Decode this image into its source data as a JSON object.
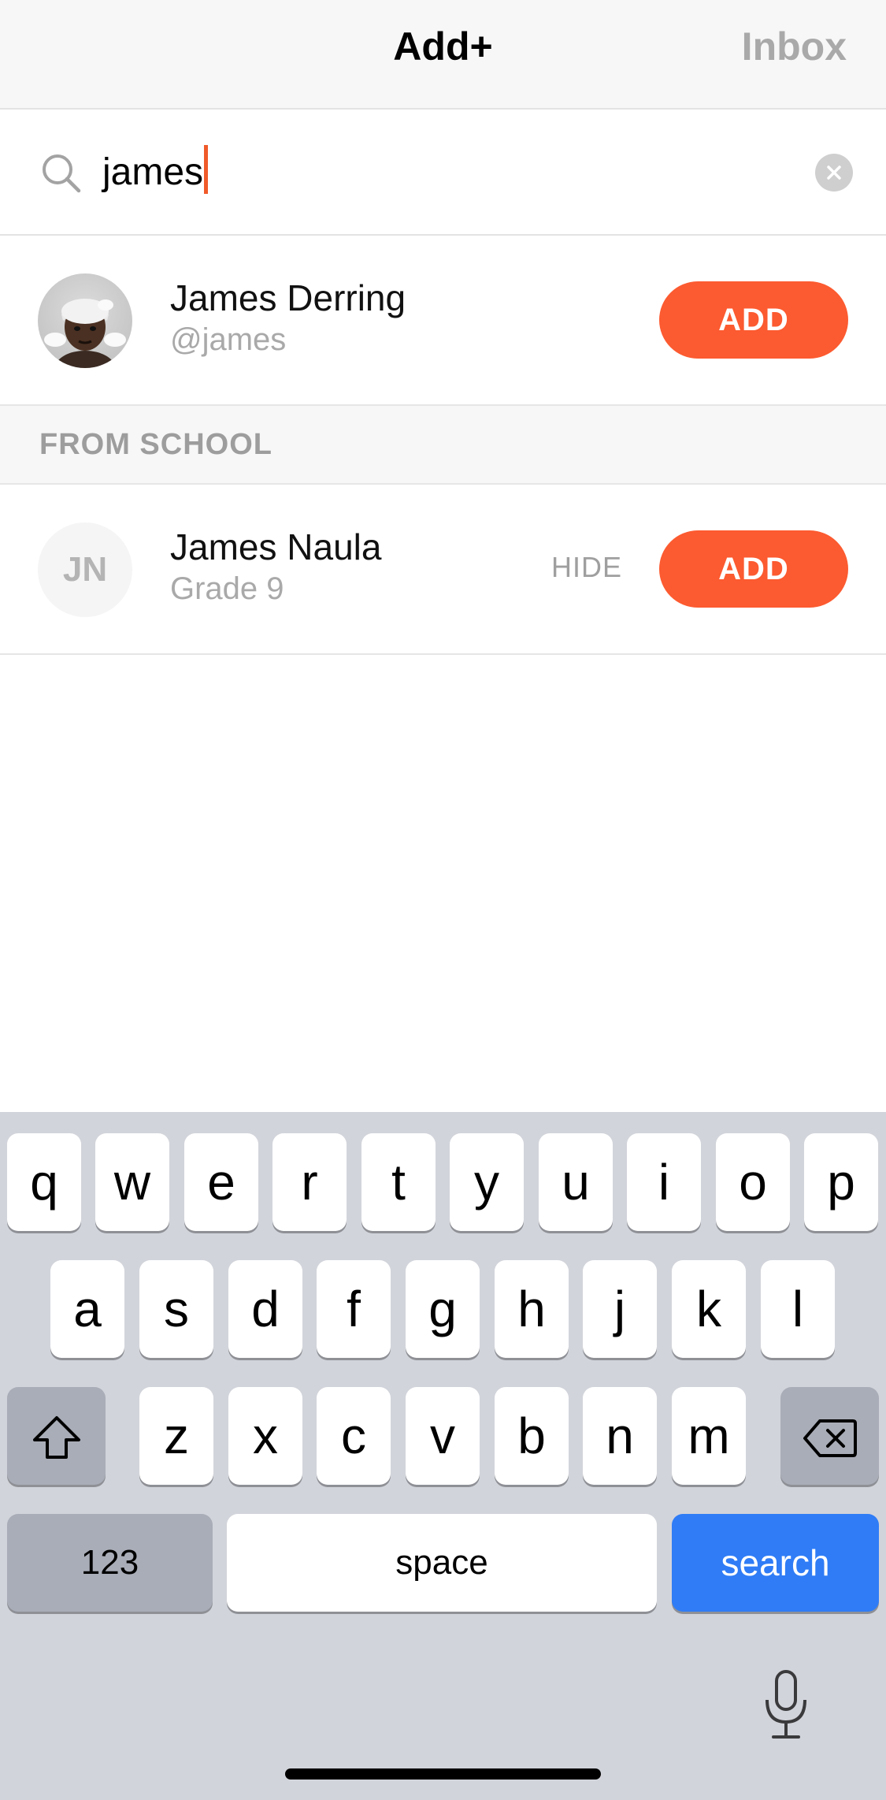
{
  "header": {
    "title": "Add+",
    "inbox_label": "Inbox"
  },
  "search": {
    "value": "james",
    "icon": "search-icon",
    "clear_icon": "clear-icon"
  },
  "results": [
    {
      "name": "James Derring",
      "subtitle": "@james",
      "avatar": "memoji-avatar",
      "add_label": "ADD"
    }
  ],
  "section": {
    "label": "FROM SCHOOL"
  },
  "school_results": [
    {
      "name": "James Naula",
      "subtitle": "Grade 9",
      "initials": "JN",
      "hide_label": "HIDE",
      "add_label": "ADD"
    }
  ],
  "keyboard": {
    "row1": [
      "q",
      "w",
      "e",
      "r",
      "t",
      "y",
      "u",
      "i",
      "o",
      "p"
    ],
    "row2": [
      "a",
      "s",
      "d",
      "f",
      "g",
      "h",
      "j",
      "k",
      "l"
    ],
    "row3": [
      "z",
      "x",
      "c",
      "v",
      "b",
      "n",
      "m"
    ],
    "numbers_label": "123",
    "space_label": "space",
    "search_label": "search",
    "shift_icon": "shift-icon",
    "delete_icon": "backspace-icon",
    "mic_icon": "microphone-icon"
  },
  "colors": {
    "accent": "#fc5a30",
    "caret": "#f05a2a",
    "keyboard_action": "#2f7cf6"
  }
}
